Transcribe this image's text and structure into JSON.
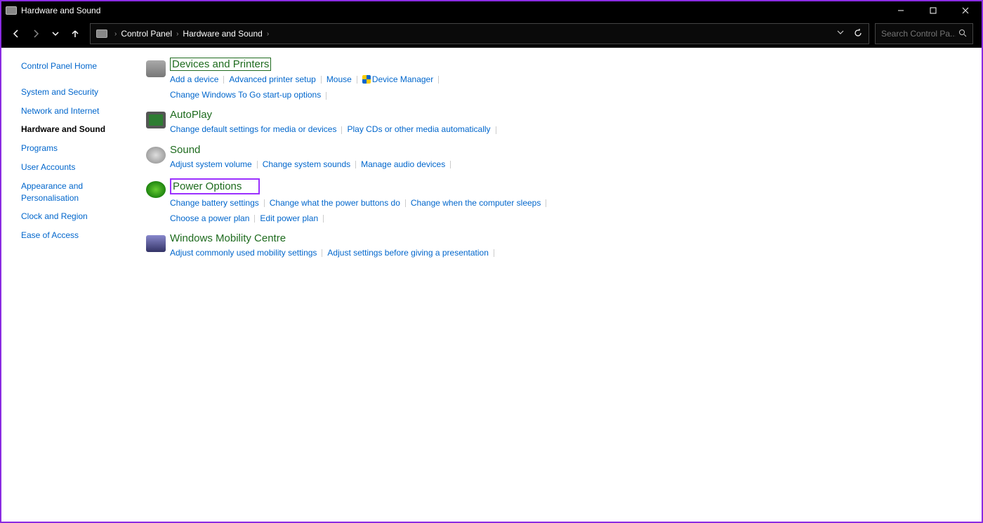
{
  "window": {
    "title": "Hardware and Sound"
  },
  "breadcrumb": {
    "seg1": "Control Panel",
    "seg2": "Hardware and Sound"
  },
  "search": {
    "placeholder": "Search Control Pa..."
  },
  "sidebar": {
    "home": "Control Panel Home",
    "items": [
      "System and Security",
      "Network and Internet",
      "Hardware and Sound",
      "Programs",
      "User Accounts",
      "Appearance and Personalisation",
      "Clock and Region",
      "Ease of Access"
    ],
    "active_index": 2
  },
  "categories": [
    {
      "title": "Devices and Printers",
      "boxed": true,
      "icon": "ico-printer",
      "links": [
        [
          "Add a device",
          "Advanced printer setup",
          "Mouse",
          "Device Manager"
        ],
        [
          "Change Windows To Go start-up options"
        ]
      ],
      "shield_on": "Device Manager"
    },
    {
      "title": "AutoPlay",
      "icon": "ico-autoplay",
      "links": [
        [
          "Change default settings for media or devices",
          "Play CDs or other media automatically"
        ]
      ]
    },
    {
      "title": "Sound",
      "icon": "ico-sound",
      "links": [
        [
          "Adjust system volume",
          "Change system sounds",
          "Manage audio devices"
        ]
      ]
    },
    {
      "title": "Power Options",
      "highlighted": true,
      "icon": "ico-power",
      "links": [
        [
          "Change battery settings",
          "Change what the power buttons do",
          "Change when the computer sleeps"
        ],
        [
          "Choose a power plan",
          "Edit power plan"
        ]
      ]
    },
    {
      "title": "Windows Mobility Centre",
      "icon": "ico-mobility",
      "links": [
        [
          "Adjust commonly used mobility settings",
          "Adjust settings before giving a presentation"
        ]
      ]
    }
  ]
}
